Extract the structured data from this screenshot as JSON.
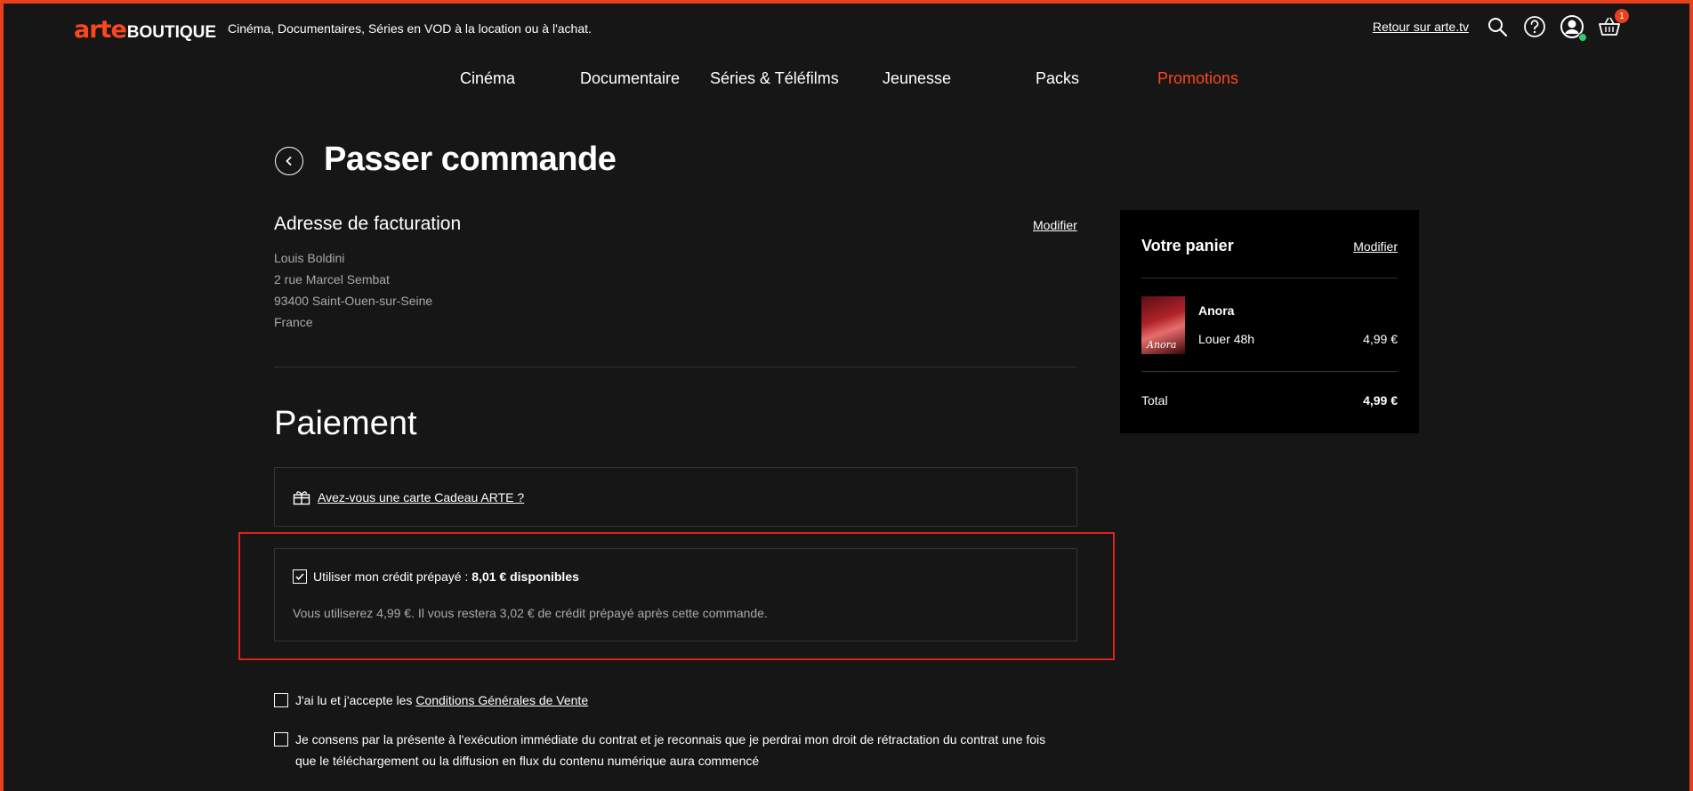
{
  "header": {
    "logo_arte": "arte",
    "logo_boutique": "BOUTIQUE",
    "tagline": "Cinéma, Documentaires, Séries en VOD à la location ou à l'achat.",
    "back_link": "Retour sur arte.tv",
    "cart_count": "1",
    "icons": [
      "search-icon",
      "help-icon",
      "user-icon",
      "basket-icon"
    ]
  },
  "nav": {
    "items": [
      "Cinéma",
      "Documentaire",
      "Séries & Téléfilms",
      "Jeunesse",
      "Packs",
      "Promotions"
    ],
    "active": "Promotions"
  },
  "page": {
    "title": "Passer commande"
  },
  "billing": {
    "title": "Adresse de facturation",
    "modify": "Modifier",
    "name": "Louis Boldini",
    "street": "2 rue Marcel Sembat",
    "city": "93400 Saint-Ouen-sur-Seine",
    "country": "France"
  },
  "payment": {
    "title": "Paiement",
    "gift_card_link": "Avez-vous une carte Cadeau ARTE ?",
    "credit_label": "Utiliser mon crédit prépayé :",
    "credit_amount": "8,01 € disponibles",
    "credit_checked": true,
    "credit_note": "Vous utiliserez 4,99 €. Il vous restera 3,02 € de crédit prépayé après cette commande."
  },
  "consents": {
    "cgv_prefix": "J'ai lu et j'accepte les",
    "cgv_link": "Conditions Générales de Vente",
    "cgv_checked": false,
    "withdrawal_text": "Je consens par la présente à l'exécution immédiate du contrat et je reconnais que je perdrai mon droit de rétractation du contrat une fois que le téléchargement ou la diffusion en flux du contenu numérique aura commencé",
    "withdrawal_checked": false
  },
  "cart": {
    "title": "Votre panier",
    "modify": "Modifier",
    "item": {
      "name": "Anora",
      "thumb_text": "Anora",
      "offer": "Louer 48h",
      "price": "4,99 €"
    },
    "total_label": "Total",
    "total_value": "4,99 €"
  },
  "colors": {
    "accent": "#fa481c",
    "background": "#161616",
    "panel": "#000000",
    "muted_text": "#a9a9a9",
    "highlight_border": "#d8241c"
  }
}
